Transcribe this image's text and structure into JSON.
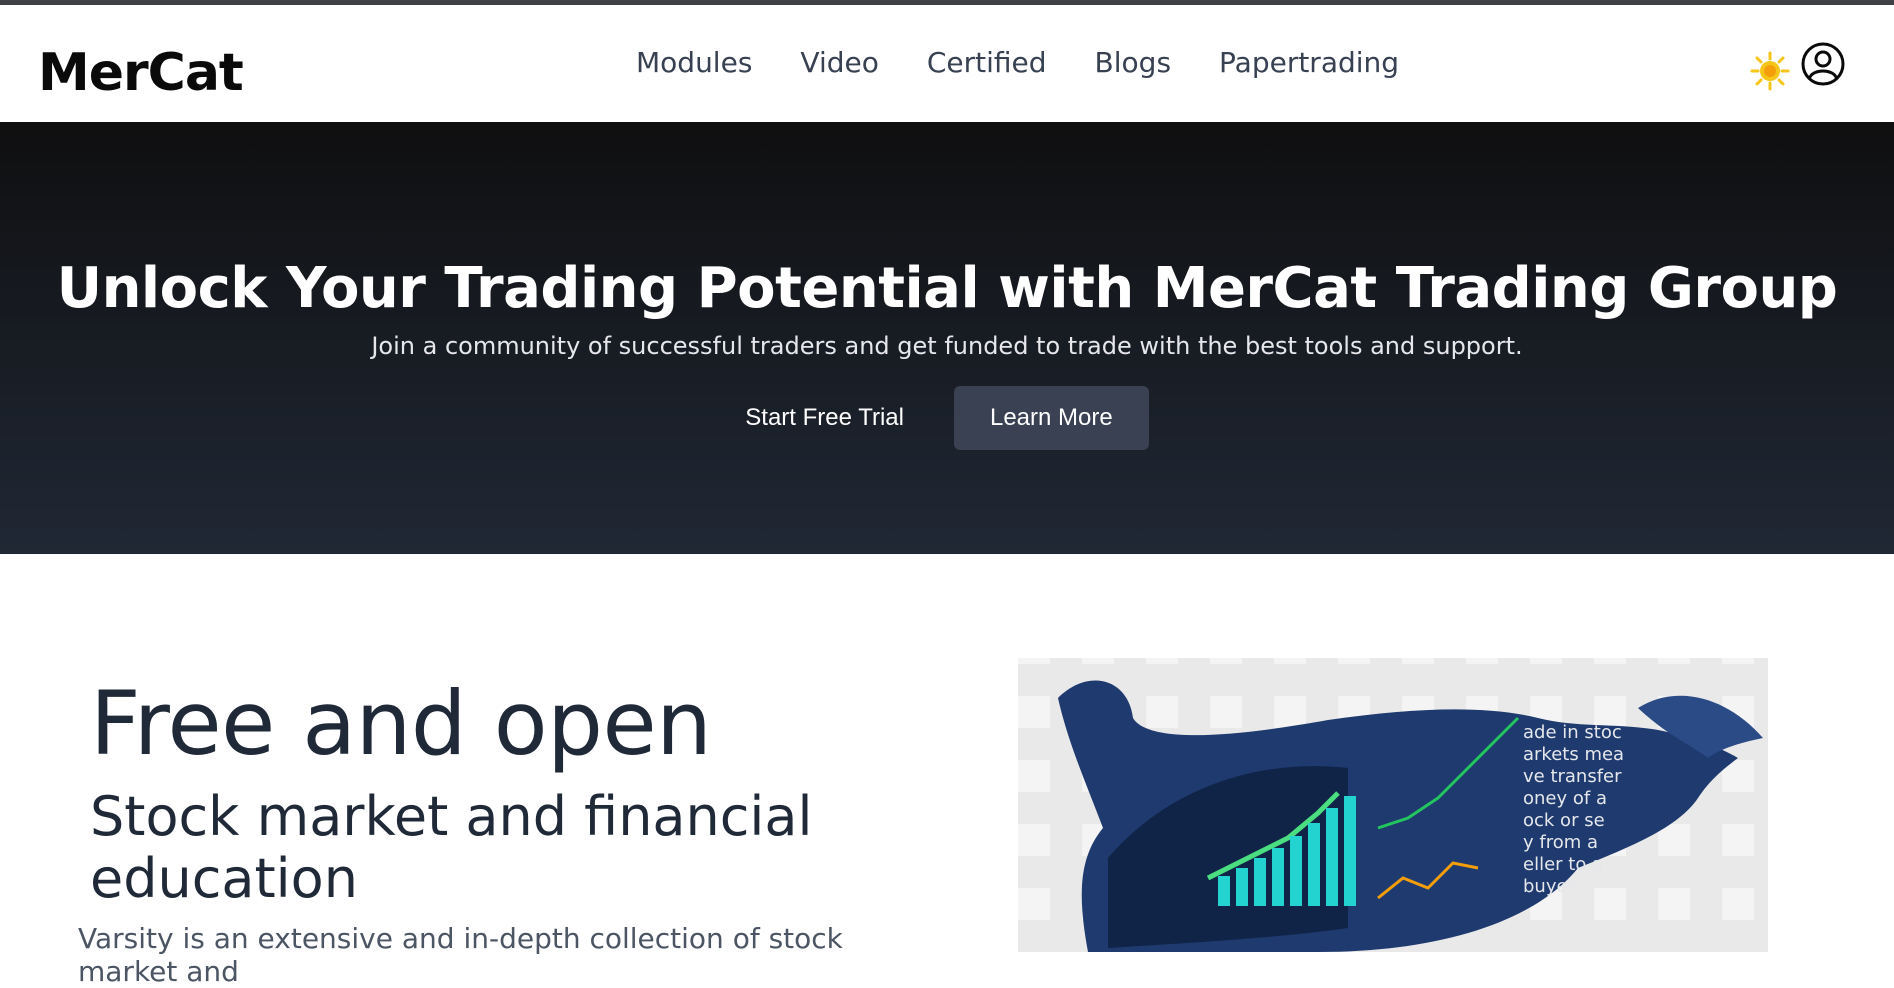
{
  "brand": {
    "name": "MerCat"
  },
  "nav": {
    "items": [
      "Modules",
      "Video",
      "Certified",
      "Blogs",
      "Papertrading"
    ],
    "icons": {
      "theme": "sun-icon",
      "account": "user-circle-icon"
    },
    "colors": {
      "sun": "#f5c518"
    }
  },
  "hero": {
    "title": "Unlock Your Trading Potential with MerCat Trading Group",
    "subtitle": "Join a community of successful traders and get funded to trade with the best tools and support.",
    "primary_cta": "Start Free Trial",
    "secondary_cta": "Learn More"
  },
  "intro": {
    "heading": "Free and open",
    "subheading": "Stock market and financial education",
    "paragraph": "Varsity is an extensive and in-depth collection of stock market and"
  },
  "image": {
    "name": "bull-chart-illustration",
    "overlay_text": [
      "ade in stoc",
      "arkets mea",
      "ve transfer",
      "oney of a",
      "ock or se",
      "y from a",
      "eller to a",
      "buyer"
    ]
  }
}
